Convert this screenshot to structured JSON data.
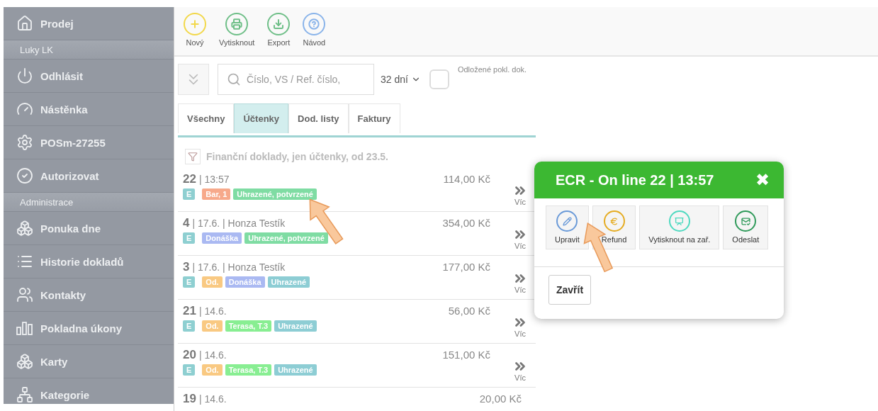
{
  "sidebar": {
    "items": [
      {
        "kind": "item",
        "label": "Prodej"
      },
      {
        "kind": "section",
        "label": "Luky LK"
      },
      {
        "kind": "item",
        "label": "Odhlásit"
      },
      {
        "kind": "item",
        "label": "Nástěnka"
      },
      {
        "kind": "item",
        "label": "POSm-27255"
      },
      {
        "kind": "item",
        "label": "Autorizovat"
      },
      {
        "kind": "section",
        "label": "Administrace"
      },
      {
        "kind": "item",
        "label": "Ponuka dne"
      },
      {
        "kind": "item",
        "label": "Historie dokladů"
      },
      {
        "kind": "item",
        "label": "Kontakty"
      },
      {
        "kind": "item",
        "label": "Pokladna úkony"
      },
      {
        "kind": "item",
        "label": "Karty"
      },
      {
        "kind": "item",
        "label": "Kategorie"
      }
    ]
  },
  "toolbar": {
    "buttons": [
      {
        "label": "Nový"
      },
      {
        "label": "Vytisknout"
      },
      {
        "label": "Export"
      },
      {
        "label": "Návod"
      }
    ]
  },
  "filter": {
    "search": {
      "placeholder": "Číslo, VS / Ref. číslo,"
    },
    "period": "32 dní",
    "postponed": {
      "label": "Odložené pokl. dok.",
      "checked": false
    }
  },
  "tabs": [
    {
      "label": "Všechny",
      "selected": false
    },
    {
      "label": "Účtenky",
      "selected": true
    },
    {
      "label": "Dod. listy",
      "selected": false
    },
    {
      "label": "Faktury",
      "selected": false
    }
  ],
  "list": {
    "summary": "Finanční doklady, jen účtenky, od 23.5.",
    "rows": [
      {
        "number": "22",
        "detail": "| 13:57",
        "amount": "114,00 Kč",
        "more": "Víc",
        "tags": [
          {
            "label": "E",
            "color": "#8ecfd1"
          },
          {
            "label": "Bar, 1",
            "color": "#f7a98b"
          },
          {
            "label": "Uhrazené, potvrzené",
            "color": "#7fdca3"
          }
        ]
      },
      {
        "number": "4",
        "detail": "| 17.6. | Honza Testík",
        "amount": "354,00 Kč",
        "more": "Víc",
        "tags": [
          {
            "label": "E",
            "color": "#8ecfd1"
          },
          {
            "label": "Donáška",
            "color": "#aab9f2"
          },
          {
            "label": "Uhrazené, potvrzené",
            "color": "#7fdca3"
          }
        ]
      },
      {
        "number": "3",
        "detail": "| 17.6. | Honza Testík",
        "amount": "177,00 Kč",
        "more": "Víc",
        "tags": [
          {
            "label": "E",
            "color": "#8ecfd1"
          },
          {
            "label": "Od.",
            "color": "#f9c982"
          },
          {
            "label": "Donáška",
            "color": "#aab9f2"
          },
          {
            "label": "Uhrazené",
            "color": "#8dcdd4"
          }
        ]
      },
      {
        "number": "21",
        "detail": "| 14.6.",
        "amount": "56,00 Kč",
        "more": "Víc",
        "tags": [
          {
            "label": "E",
            "color": "#8ecfd1"
          },
          {
            "label": "Od.",
            "color": "#f9c982"
          },
          {
            "label": "Terasa, T.3",
            "color": "#88ee92"
          },
          {
            "label": "Uhrazené",
            "color": "#8dcdd4"
          }
        ]
      },
      {
        "number": "20",
        "detail": "| 14.6.",
        "amount": "151,00 Kč",
        "more": "Víc",
        "tags": [
          {
            "label": "E",
            "color": "#8ecfd1"
          },
          {
            "label": "Od.",
            "color": "#f9c982"
          },
          {
            "label": "Terasa, T.3",
            "color": "#88ee92"
          },
          {
            "label": "Uhrazené",
            "color": "#8dcdd4"
          }
        ]
      },
      {
        "number": "19",
        "detail": "| 14.6.",
        "amount": "20,00 Kč"
      }
    ]
  },
  "dialog": {
    "title": "ECR - On line 22 | 13:57",
    "close": "✖",
    "actions": [
      {
        "label": "Upravit"
      },
      {
        "label": "Refund"
      },
      {
        "label": "Vytisknout na zař."
      },
      {
        "label": "Odeslat"
      }
    ],
    "buttons": [
      "Zavřít"
    ]
  }
}
